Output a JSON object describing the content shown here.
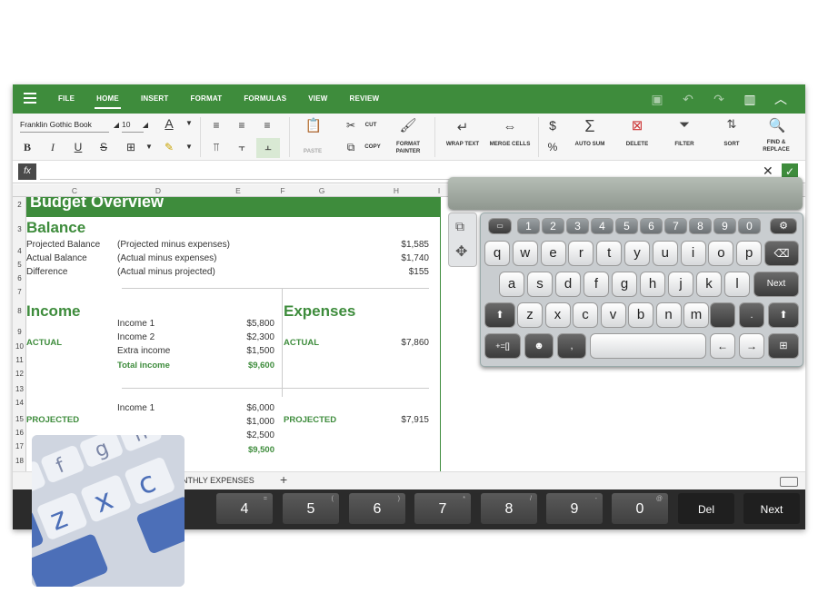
{
  "menubar": {
    "items": [
      "FILE",
      "HOME",
      "INSERT",
      "FORMAT",
      "FORMULAS",
      "VIEW",
      "REVIEW"
    ],
    "active": "HOME"
  },
  "ribbon": {
    "font_name": "Franklin Gothic Book",
    "font_size": "10",
    "paste": "PASTE",
    "cut": "CUT",
    "copy": "COPY",
    "format_painter": "FORMAT PAINTER",
    "wrap_text": "WRAP TEXT",
    "merge_cells": "MERGE CELLS",
    "currency": "$",
    "percent": "%",
    "auto_sum": "AUTO SUM",
    "delete": "DELETE",
    "filter": "FILTER",
    "sort": "SORT",
    "find_replace": "FIND & REPLACE",
    "bold": "B",
    "italic": "I",
    "underline": "U",
    "strike": "S",
    "font_color": "A"
  },
  "formula": {
    "fx": "fx",
    "value": ""
  },
  "columns": [
    "C",
    "D",
    "E",
    "F",
    "G",
    "H",
    "I"
  ],
  "rows": [
    "2",
    "3",
    "4",
    "5",
    "6",
    "7",
    "8",
    "9",
    "10",
    "11",
    "12",
    "13",
    "14",
    "15",
    "16",
    "17",
    "18"
  ],
  "band_title": "Budget Overview",
  "balance": {
    "title": "Balance",
    "rows": [
      {
        "label": "Projected Balance",
        "desc": "(Projected  minus expenses)",
        "value": "$1,585"
      },
      {
        "label": "Actual Balance",
        "desc": "(Actual  minus expenses)",
        "value": "$1,740"
      },
      {
        "label": "Difference",
        "desc": "(Actual minus projected)",
        "value": "$155"
      }
    ]
  },
  "income": {
    "title": "Income",
    "actual_label": "ACTUAL",
    "projected_label": "PROJECTED",
    "actual": [
      {
        "name": "Income 1",
        "value": "$5,800"
      },
      {
        "name": "Income 2",
        "value": "$2,300"
      },
      {
        "name": "Extra income",
        "value": "$1,500"
      }
    ],
    "actual_total": {
      "name": "Total income",
      "value": "$9,600"
    },
    "projected": [
      {
        "name": "Income 1",
        "value": "$6,000"
      },
      {
        "name": "",
        "value": "$1,000"
      },
      {
        "name": "",
        "value": "$2,500"
      }
    ],
    "projected_total": {
      "name": "",
      "value": "$9,500"
    }
  },
  "expenses": {
    "title": "Expenses",
    "actual_label": "ACTUAL",
    "actual_value": "$7,860",
    "projected_label": "PROJECTED",
    "projected_value": "$7,915"
  },
  "tabs": {
    "sheet": "NTHLY EXPENSES",
    "add": "+"
  },
  "number_row": {
    "keys": [
      "4",
      "5",
      "6",
      "7",
      "8",
      "9",
      "0"
    ],
    "subs": [
      "=",
      "(",
      ")",
      "*",
      "/",
      "-",
      "@"
    ],
    "del": "Del",
    "next": "Next"
  },
  "keyboard": {
    "numbers": [
      "1",
      "2",
      "3",
      "4",
      "5",
      "6",
      "7",
      "8",
      "9",
      "0"
    ],
    "row1": [
      "q",
      "w",
      "e",
      "r",
      "t",
      "y",
      "u",
      "i",
      "o",
      "p"
    ],
    "row2": [
      "a",
      "s",
      "d",
      "f",
      "g",
      "h",
      "j",
      "k",
      "l"
    ],
    "row3": [
      "z",
      "x",
      "c",
      "v",
      "b",
      "n",
      "m"
    ],
    "next": "Next",
    "sym": "+=[]",
    "comma": ","
  },
  "colors": {
    "accent": "#3e8c3c"
  }
}
